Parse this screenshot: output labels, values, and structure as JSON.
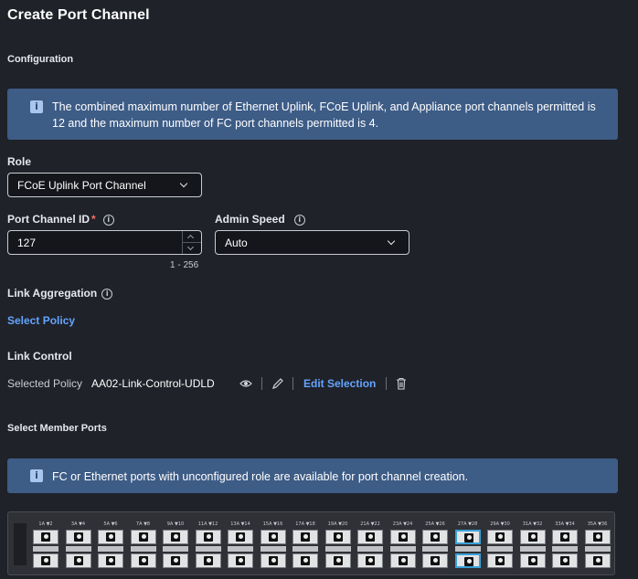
{
  "page": {
    "title": "Create Port Channel"
  },
  "configuration": {
    "heading": "Configuration",
    "banner_text": "The combined maximum number of Ethernet Uplink, FCoE Uplink, and Appliance port channels permitted is 12 and the maximum number of FC port channels permitted is 4."
  },
  "role": {
    "label": "Role",
    "value": "FCoE Uplink Port Channel"
  },
  "port_channel_id": {
    "label": "Port Channel ID",
    "required_mark": "*",
    "value": "127",
    "range_hint": "1 - 256"
  },
  "admin_speed": {
    "label": "Admin Speed",
    "value": "Auto"
  },
  "link_aggregation": {
    "label": "Link Aggregation",
    "action": "Select Policy"
  },
  "link_control": {
    "label": "Link Control",
    "selected_label": "Selected Policy",
    "policy_name": "AA02-Link-Control-UDLD",
    "edit_label": "Edit Selection"
  },
  "member_ports": {
    "heading": "Select Member Ports",
    "banner_text": "FC or Ethernet ports with unconfigured role are available for port channel creation.",
    "port_pairs": [
      "1",
      "3",
      "5",
      "7",
      "9",
      "11",
      "13",
      "15",
      "17",
      "19",
      "21",
      "23",
      "25",
      "27",
      "29",
      "31",
      "33",
      "35"
    ],
    "selected_pair": "27"
  },
  "colors": {
    "accent": "#64a4ff",
    "banner": "#3d5c86",
    "background": "#1f2229",
    "selection": "#3aa1d8"
  }
}
